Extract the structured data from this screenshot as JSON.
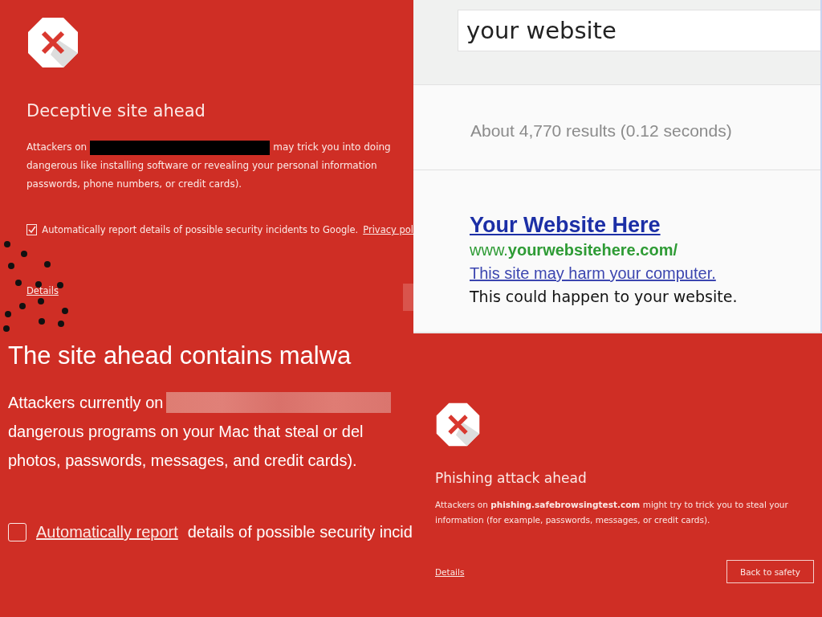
{
  "deceptive_warning": {
    "title": "Deceptive site ahead",
    "lines": [
      [
        {
          "kind": "text",
          "text": "Attackers on"
        },
        {
          "kind": "redaction"
        },
        {
          "kind": "text",
          "text": "may trick you into doing"
        }
      ],
      [
        {
          "kind": "text",
          "text": "dangerous like installing software or revealing your personal information"
        }
      ],
      [
        {
          "kind": "text",
          "text": "passwords, phone numbers, or credit cards)."
        }
      ]
    ],
    "report": {
      "checked": true,
      "text": "Automatically report details of possible security incidents to Google.",
      "link": "Privacy pol"
    },
    "details_link": "Details"
  },
  "search_results": {
    "query": "your website",
    "stats": "About 4,770 results (0.12 seconds)",
    "result": {
      "title": "Your Website Here",
      "url": "www.**yourwebsitehere.com/**",
      "warning": "This site may harm your computer.",
      "note": "This could happen to your website."
    }
  },
  "malware_warning": {
    "title": "The site ahead contains malwa",
    "lines": [
      [
        {
          "kind": "text",
          "text": "Attackers currently on"
        },
        {
          "kind": "blur"
        }
      ],
      [
        {
          "kind": "text",
          "text": "dangerous programs on your Mac that steal or del"
        }
      ],
      [
        {
          "kind": "text",
          "text": "photos, passwords, messages, and credit cards)."
        }
      ]
    ],
    "report": {
      "checked": false,
      "link": "Automatically report",
      "text": "details of possible security incid"
    }
  },
  "phishing_warning": {
    "title": "Phishing attack ahead",
    "body": "Attackers on **phishing.safebrowsingtest.com** might try to trick you to steal your information (for example, passwords, messages, or credit cards).",
    "details_link": "Details",
    "button": "Back to safety"
  }
}
